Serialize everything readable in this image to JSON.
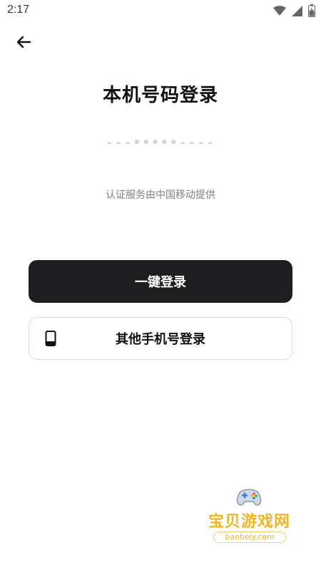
{
  "status_bar": {
    "time": "2:17",
    "icons": [
      "wifi-icon",
      "signal-icon",
      "battery-icon"
    ]
  },
  "header": {
    "back_icon": "arrow-left-icon"
  },
  "main": {
    "title": "本机号码登录",
    "masked_number": "---•••••----",
    "auth_provider": "认证服务由中国移动提供"
  },
  "actions": {
    "one_click_login": "一键登录",
    "other_phone_login": "其他手机号登录",
    "other_phone_icon": "phone-icon"
  },
  "watermark": {
    "title": "宝贝游戏网",
    "url": "baobeiy.com"
  },
  "colors": {
    "primary_button": "#1e1e20",
    "watermark": "#f3b421"
  }
}
